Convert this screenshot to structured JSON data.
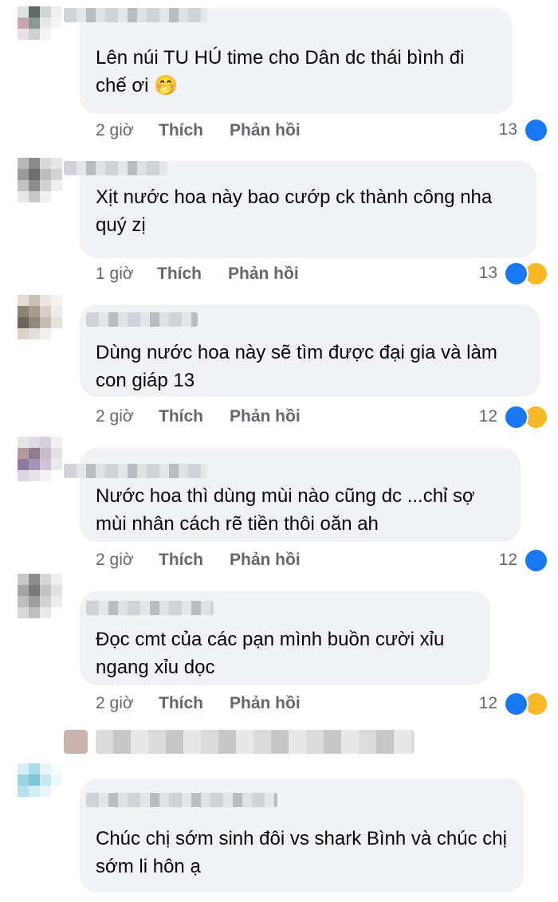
{
  "labels": {
    "like": "Thích",
    "reply": "Phản hồi"
  },
  "comments": [
    {
      "text": "Lên núi TU HÚ time cho Dân dc thái bình đi chế ơi",
      "emoji": "🤭",
      "time": "2 giờ",
      "reactions": "13",
      "icons": [
        "like-icon"
      ]
    },
    {
      "text": "Xịt nước hoa này bao cướp ck thành công nha quý zị",
      "time": "1 giờ",
      "reactions": "13",
      "icons": [
        "like-icon",
        "haha-icon"
      ]
    },
    {
      "text": "Dùng nước hoa này sẽ tìm được đại gia và làm con giáp 13",
      "time": "2 giờ",
      "reactions": "12",
      "icons": [
        "like-icon",
        "haha-icon"
      ]
    },
    {
      "text": "Nước hoa thì dùng mùi nào cũng dc ...chỉ sợ mùi nhân cách rẽ tiền thôi oăn ah",
      "time": "2 giờ",
      "reactions": "12",
      "icons": [
        "like-icon"
      ]
    },
    {
      "text": "Đọc cmt của các pạn mình buồn cười xỉu ngang xỉu dọc",
      "time": "2 giờ",
      "reactions": "12",
      "icons": [
        "like-icon",
        "haha-icon"
      ]
    },
    {
      "text": "Chúc chị sớm sinh đôi vs shark Bình và chúc chị sớm li hôn ạ"
    }
  ],
  "colors": {
    "bubble": "#f0f2f5",
    "meta": "#65676b",
    "like": "#1877f2",
    "haha": "#f7b928"
  }
}
